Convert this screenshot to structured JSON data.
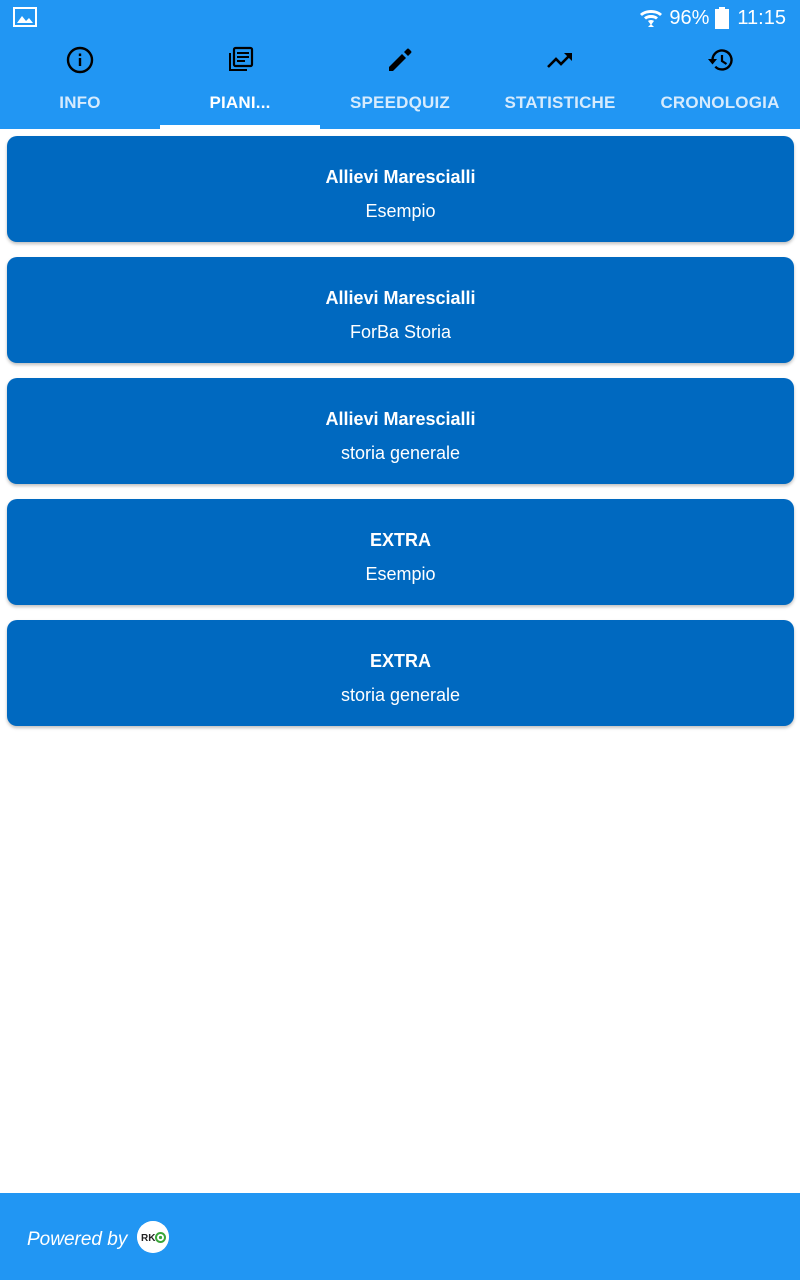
{
  "status_bar": {
    "battery_percent": "96%",
    "time": "11:15",
    "icons": [
      "image-icon",
      "wifi-icon",
      "battery-icon"
    ]
  },
  "tabs": [
    {
      "label": "INFO",
      "icon": "info-icon",
      "active": false
    },
    {
      "label": "PIANI...",
      "icon": "library-books-icon",
      "active": true
    },
    {
      "label": "SPEEDQUIZ",
      "icon": "pencil-icon",
      "active": false
    },
    {
      "label": "STATISTICHE",
      "icon": "trending-up-icon",
      "active": false
    },
    {
      "label": "CRONOLOGIA",
      "icon": "history-icon",
      "active": false
    }
  ],
  "cards": [
    {
      "title": "Allievi Marescialli",
      "subtitle": "Esempio"
    },
    {
      "title": "Allievi Marescialli",
      "subtitle": "ForBa Storia"
    },
    {
      "title": "Allievi Marescialli",
      "subtitle": "storia generale"
    },
    {
      "title": "EXTRA",
      "subtitle": "Esempio"
    },
    {
      "title": "EXTRA",
      "subtitle": "storia generale"
    }
  ],
  "footer": {
    "powered_by": "Powered by",
    "logo_text": "RK"
  },
  "colors": {
    "primary": "#2196f3",
    "card": "#0069c0",
    "text": "#ffffff"
  }
}
